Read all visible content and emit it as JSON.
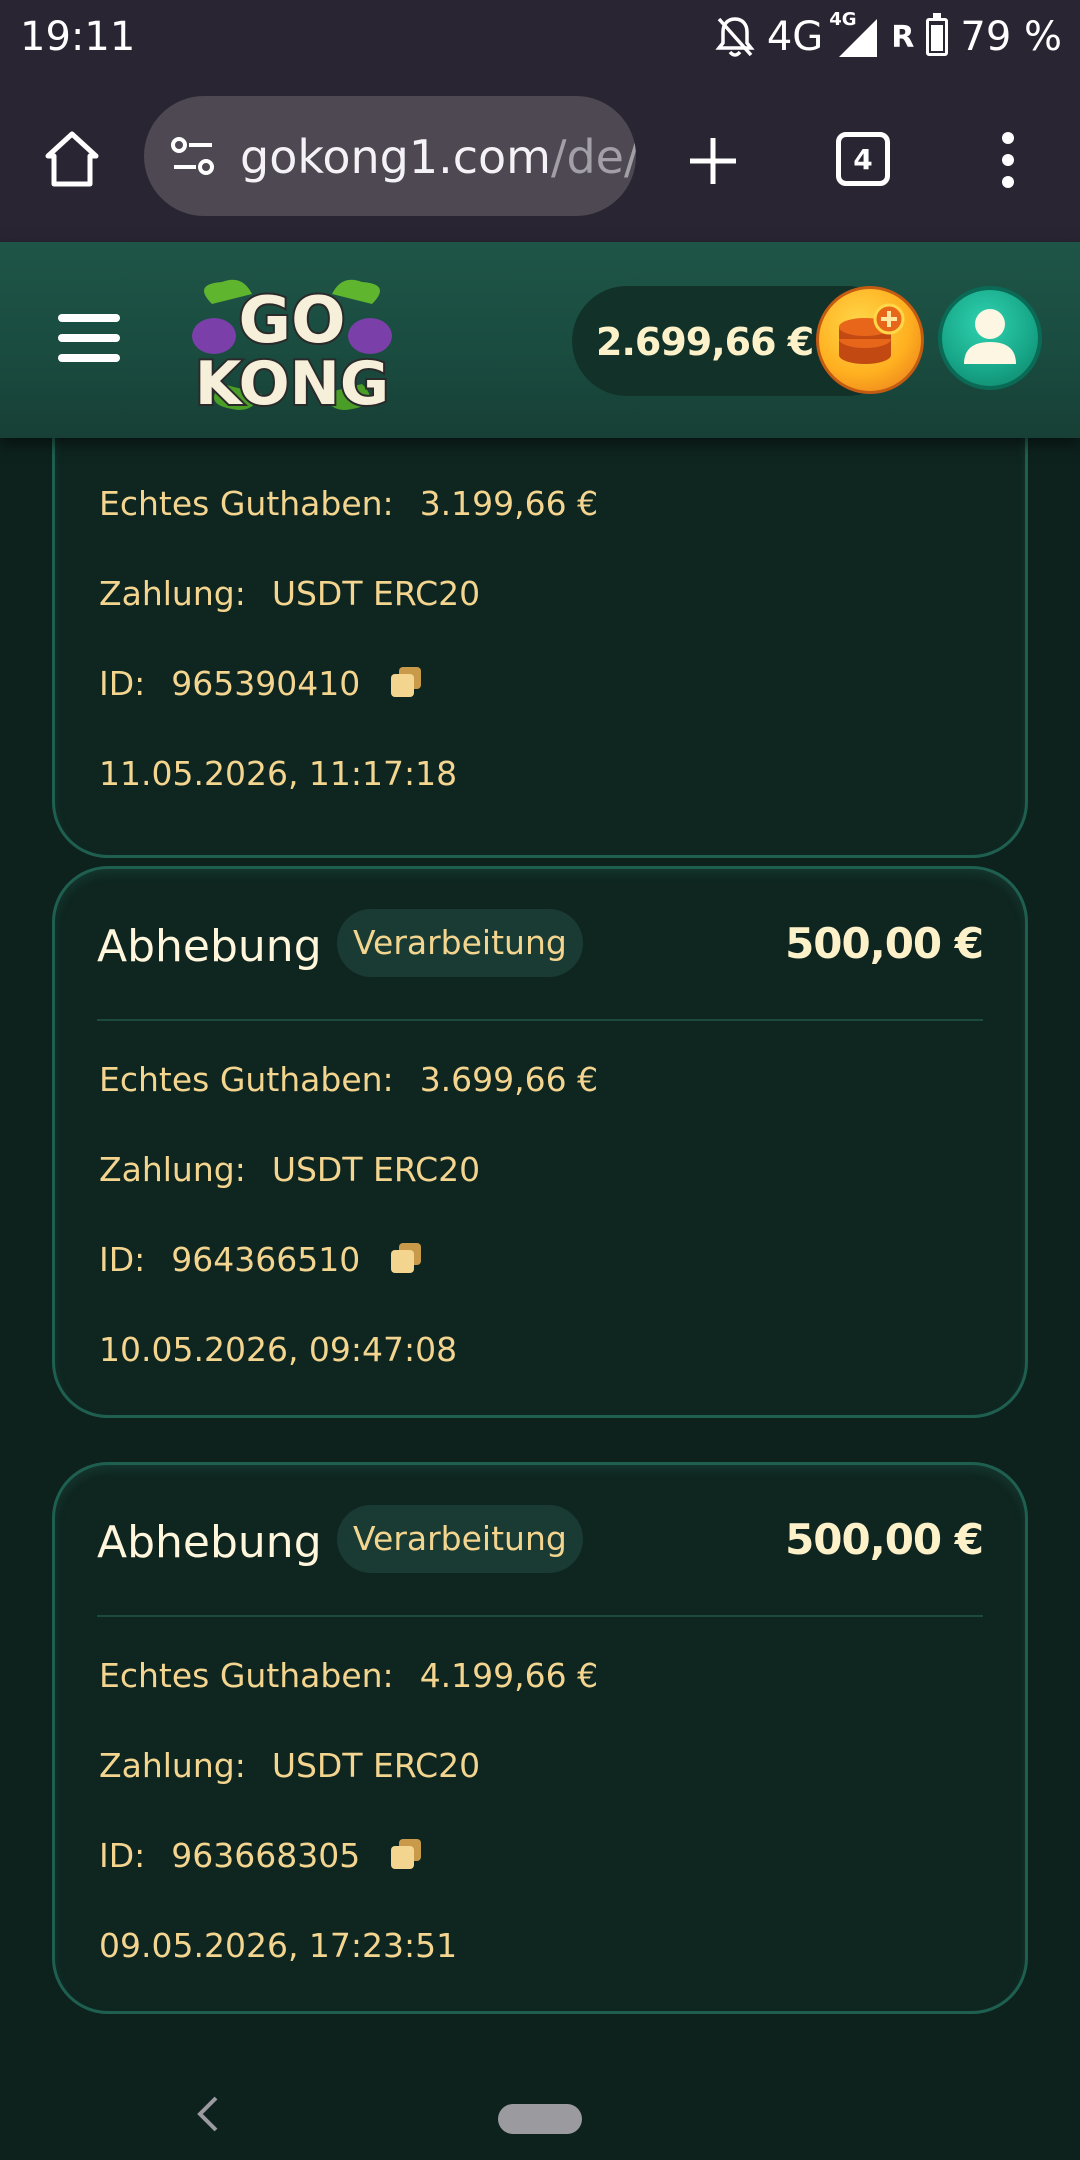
{
  "status_bar": {
    "time": "19:11",
    "network": "4G",
    "network_small": "4G",
    "roaming": "R",
    "battery": "79 %"
  },
  "browser": {
    "url_host": "gokong1.com",
    "url_path": "/de/",
    "tab_count": "4"
  },
  "header": {
    "logo_top": "GO",
    "logo_bottom": "KONG",
    "balance": "2.699,66 €"
  },
  "labels": {
    "real_balance": "Echtes Guthaben:",
    "payment": "Zahlung:",
    "id": "ID:"
  },
  "transactions": [
    {
      "real_balance": "3.199,66 €",
      "payment": "USDT ERC20",
      "id": "965390410",
      "datetime": "11.05.2026, 11:17:18"
    },
    {
      "title": "Abhebung",
      "status": "Verarbeitung",
      "amount": "500,00 €",
      "real_balance": "3.699,66 €",
      "payment": "USDT ERC20",
      "id": "964366510",
      "datetime": "10.05.2026, 09:47:08"
    },
    {
      "title": "Abhebung",
      "status": "Verarbeitung",
      "amount": "500,00 €",
      "real_balance": "4.199,66 €",
      "payment": "USDT ERC20",
      "id": "963668305",
      "datetime": "09.05.2026, 17:23:51"
    }
  ],
  "colors": {
    "accent_gold": "#f3d58f",
    "header_green": "#1e5547",
    "card_bg": "#0f2520",
    "card_border": "#1f5f50"
  }
}
